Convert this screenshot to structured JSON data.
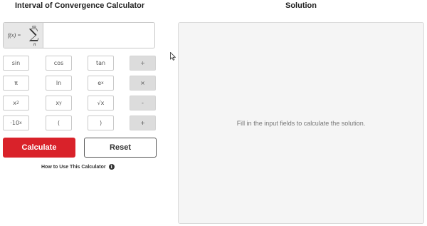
{
  "calculator": {
    "title": "Interval of Convergence Calculator",
    "function_label": "f(x) =",
    "sum_upper": "∞",
    "sum_symbol": "∑",
    "sum_lower": "n",
    "expression_value": "",
    "calculate_label": "Calculate",
    "reset_label": "Reset",
    "how_to_label": "How to Use This Calculator",
    "info_icon_glyph": "i"
  },
  "keypad": {
    "sin": "sin",
    "cos": "cos",
    "tan": "tan",
    "divide": "÷",
    "pi": "π",
    "ln": "ln",
    "exp_base": "e",
    "exp_sup": "x",
    "multiply": "×",
    "square_base": "x",
    "square_sup": "2",
    "power_base": "x",
    "power_sup": "y",
    "sqrt": "√x",
    "minus": "-",
    "ten_base": "·10",
    "ten_sup": "x",
    "open_paren": "(",
    "close_paren": ")",
    "plus": "+"
  },
  "solution": {
    "title": "Solution",
    "placeholder": "Fill in the input fields to calculate the solution."
  },
  "colors": {
    "calculate_button": "#d9222a",
    "operator_key": "#dcdcdc",
    "solution_bg": "#f5f5f5"
  },
  "icons": {
    "info": "info-circle-icon",
    "cursor": "mouse-pointer-icon"
  }
}
